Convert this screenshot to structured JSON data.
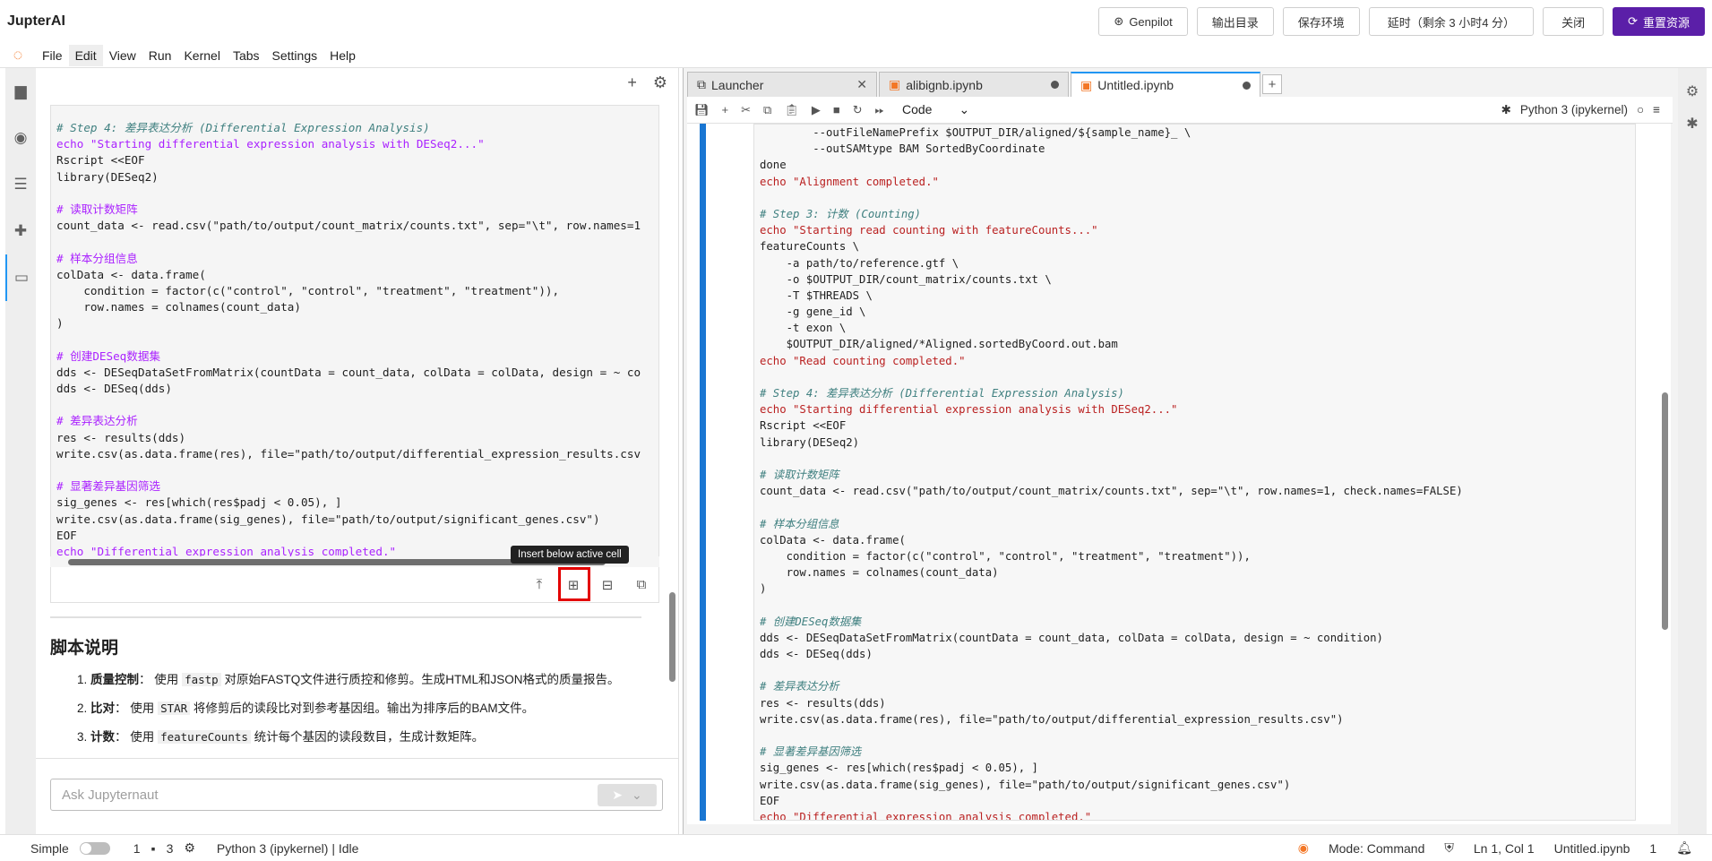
{
  "app": {
    "title": "JupterAI"
  },
  "top_actions": {
    "genpilot": "Genpilot",
    "output_dir": "输出目录",
    "save_env": "保存环境",
    "extend": "延时（剩余 3 小时4 分）",
    "close": "关闭",
    "reset": "重置资源"
  },
  "menu": [
    "File",
    "Edit",
    "View",
    "Run",
    "Kernel",
    "Tabs",
    "Settings",
    "Help"
  ],
  "left_cell_code": [
    [
      "c",
      "# Step 4: 差异表达分析 (Differential Expression Analysis)"
    ],
    [
      "p",
      "echo \"Starting differential expression analysis with DESeq2...\""
    ],
    [
      "t",
      "Rscript <<EOF"
    ],
    [
      "t",
      "library(DESeq2)"
    ],
    [
      "t",
      ""
    ],
    [
      "p",
      "# 读取计数矩阵"
    ],
    [
      "t",
      "count_data <- read.csv(\"path/to/output/count_matrix/counts.txt\", sep=\"\\t\", row.names=1"
    ],
    [
      "t",
      ""
    ],
    [
      "p",
      "# 样本分组信息"
    ],
    [
      "t",
      "colData <- data.frame("
    ],
    [
      "t",
      "    condition = factor(c(\"control\", \"control\", \"treatment\", \"treatment\")),"
    ],
    [
      "t",
      "    row.names = colnames(count_data)"
    ],
    [
      "t",
      ")"
    ],
    [
      "t",
      ""
    ],
    [
      "p",
      "# 创建DESeq数据集"
    ],
    [
      "t",
      "dds <- DESeqDataSetFromMatrix(countData = count_data, colData = colData, design = ~ co"
    ],
    [
      "t",
      "dds <- DESeq(dds)"
    ],
    [
      "t",
      ""
    ],
    [
      "p",
      "# 差异表达分析"
    ],
    [
      "t",
      "res <- results(dds)"
    ],
    [
      "t",
      "write.csv(as.data.frame(res), file=\"path/to/output/differential_expression_results.csv"
    ],
    [
      "t",
      ""
    ],
    [
      "p",
      "# 显著差异基因筛选"
    ],
    [
      "t",
      "sig_genes <- res[which(res$padj < 0.05), ]"
    ],
    [
      "t",
      "write.csv(as.data.frame(sig_genes), file=\"path/to/output/significant_genes.csv\")"
    ],
    [
      "t",
      "EOF"
    ],
    [
      "p",
      "echo \"Differential expression analysis completed.\""
    ]
  ],
  "tooltip": "Insert below active cell",
  "markdown": {
    "heading": "脚本说明",
    "items": [
      {
        "num": "1.",
        "title": "质量控制",
        "pre": "使用 ",
        "code": "fastp",
        "post": " 对原始FASTQ文件进行质控和修剪。生成HTML和JSON格式的质量报告。"
      },
      {
        "num": "2.",
        "title": "比对",
        "pre": "使用 ",
        "code": "STAR",
        "post": " 将修剪后的读段比对到参考基因组。输出为排序后的BAM文件。"
      },
      {
        "num": "3.",
        "title": "计数",
        "pre": "使用 ",
        "code": "featureCounts",
        "post": " 统计每个基因的读段数目，生成计数矩阵。"
      }
    ]
  },
  "chat": {
    "placeholder": "Ask Jupyternaut"
  },
  "tabs": [
    {
      "label": "Launcher"
    },
    {
      "label": "alibignb.ipynb"
    },
    {
      "label": "Untitled.ipynb"
    }
  ],
  "nb_toolbar": {
    "cell_type": "Code",
    "kernel": "Python 3 (ipykernel)"
  },
  "nb_code": [
    [
      "t",
      "        --outFileNamePrefix $OUTPUT_DIR/aligned/${sample_name}_ \\"
    ],
    [
      "t",
      "        --outSAMtype BAM SortedByCoordinate"
    ],
    [
      "t",
      "done"
    ],
    [
      "s",
      "echo \"Alignment completed.\""
    ],
    [
      "t",
      ""
    ],
    [
      "c",
      "# Step 3: 计数 (Counting)"
    ],
    [
      "s",
      "echo \"Starting read counting with featureCounts...\""
    ],
    [
      "t",
      "featureCounts \\"
    ],
    [
      "t",
      "    -a path/to/reference.gtf \\"
    ],
    [
      "t",
      "    -o $OUTPUT_DIR/count_matrix/counts.txt \\"
    ],
    [
      "t",
      "    -T $THREADS \\"
    ],
    [
      "t",
      "    -g gene_id \\"
    ],
    [
      "t",
      "    -t exon \\"
    ],
    [
      "t",
      "    $OUTPUT_DIR/aligned/*Aligned.sortedByCoord.out.bam"
    ],
    [
      "s",
      "echo \"Read counting completed.\""
    ],
    [
      "t",
      ""
    ],
    [
      "c",
      "# Step 4: 差异表达分析 (Differential Expression Analysis)"
    ],
    [
      "s",
      "echo \"Starting differential expression analysis with DESeq2...\""
    ],
    [
      "t",
      "Rscript <<EOF"
    ],
    [
      "t",
      "library(DESeq2)"
    ],
    [
      "t",
      ""
    ],
    [
      "c",
      "# 读取计数矩阵"
    ],
    [
      "t",
      "count_data <- read.csv(\"path/to/output/count_matrix/counts.txt\", sep=\"\\t\", row.names=1, check.names=FALSE)"
    ],
    [
      "t",
      ""
    ],
    [
      "c",
      "# 样本分组信息"
    ],
    [
      "t",
      "colData <- data.frame("
    ],
    [
      "t",
      "    condition = factor(c(\"control\", \"control\", \"treatment\", \"treatment\")),"
    ],
    [
      "t",
      "    row.names = colnames(count_data)"
    ],
    [
      "t",
      ")"
    ],
    [
      "t",
      ""
    ],
    [
      "c",
      "# 创建DESeq数据集"
    ],
    [
      "t",
      "dds <- DESeqDataSetFromMatrix(countData = count_data, colData = colData, design = ~ condition)"
    ],
    [
      "t",
      "dds <- DESeq(dds)"
    ],
    [
      "t",
      ""
    ],
    [
      "c",
      "# 差异表达分析"
    ],
    [
      "t",
      "res <- results(dds)"
    ],
    [
      "t",
      "write.csv(as.data.frame(res), file=\"path/to/output/differential_expression_results.csv\")"
    ],
    [
      "t",
      ""
    ],
    [
      "c",
      "# 显著差异基因筛选"
    ],
    [
      "t",
      "sig_genes <- res[which(res$padj < 0.05), ]"
    ],
    [
      "t",
      "write.csv(as.data.frame(sig_genes), file=\"path/to/output/significant_genes.csv\")"
    ],
    [
      "t",
      "EOF"
    ],
    [
      "s",
      "echo \"Differential expression analysis completed.\""
    ]
  ],
  "status": {
    "simple": "Simple",
    "count1": "1",
    "count2": "3",
    "kernel_status": "Python 3 (ipykernel) | Idle",
    "mode": "Mode: Command",
    "position": "Ln 1, Col 1",
    "file": "Untitled.ipynb",
    "notif": "1"
  },
  "colors": {
    "accent": "#1976d2",
    "brand": "#5b1fa8",
    "highlight": "#e30000"
  }
}
